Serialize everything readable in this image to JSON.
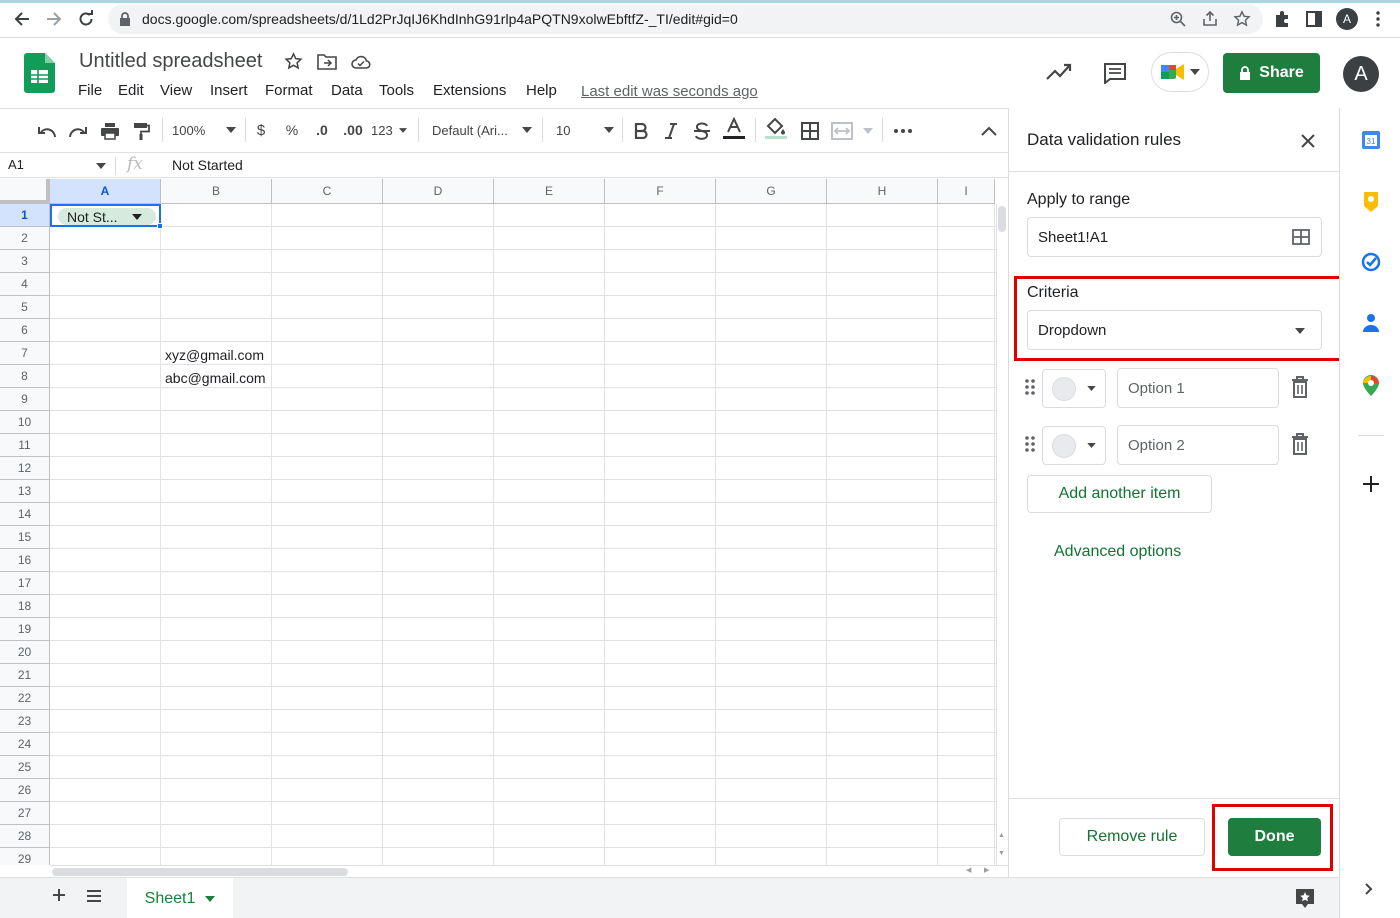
{
  "browser": {
    "url": "docs.google.com/spreadsheets/d/1Ld2PrJqIJ6KhdInhG91rlp4aPQTN9xolwEbftfZ-_TI/edit#gid=0",
    "profile_initial": "A"
  },
  "app": {
    "title": "Untitled spreadsheet",
    "menu": [
      "File",
      "Edit",
      "View",
      "Insert",
      "Format",
      "Data",
      "Tools",
      "Extensions",
      "Help"
    ],
    "last_edit": "Last edit was seconds ago",
    "share_label": "Share",
    "avatar_initial": "A",
    "brand_color": "#188038"
  },
  "toolbar": {
    "zoom": "100%",
    "currency": "$",
    "percent": "%",
    "decrease_decimal": ".0",
    "increase_decimal": ".00",
    "more_formats": "123",
    "font": "Default (Ari...",
    "font_size": "10"
  },
  "formula_bar": {
    "cell_ref": "A1",
    "fx": "fx",
    "content": "Not Started"
  },
  "grid": {
    "columns": [
      "A",
      "B",
      "C",
      "D",
      "E",
      "F",
      "G",
      "H",
      "I"
    ],
    "rows": [
      "1",
      "2",
      "3",
      "4",
      "5",
      "6",
      "7",
      "8",
      "9",
      "10",
      "11",
      "12",
      "13",
      "14",
      "15",
      "16",
      "17",
      "18",
      "19",
      "20",
      "21",
      "22",
      "23",
      "24",
      "25",
      "26",
      "27",
      "28",
      "29"
    ],
    "a1_chip": "Not St...",
    "b7": "xyz@gmail.com",
    "b8": "abc@gmail.com"
  },
  "sheet_tabs": {
    "active": "Sheet1"
  },
  "panel": {
    "title": "Data validation rules",
    "apply_label": "Apply to range",
    "range": "Sheet1!A1",
    "criteria_label": "Criteria",
    "criteria_value": "Dropdown",
    "options": [
      {
        "placeholder": "Option 1"
      },
      {
        "placeholder": "Option 2"
      }
    ],
    "add_item": "Add another item",
    "advanced": "Advanced options",
    "remove_rule": "Remove rule",
    "done": "Done",
    "highlight_color": "#e00000"
  }
}
